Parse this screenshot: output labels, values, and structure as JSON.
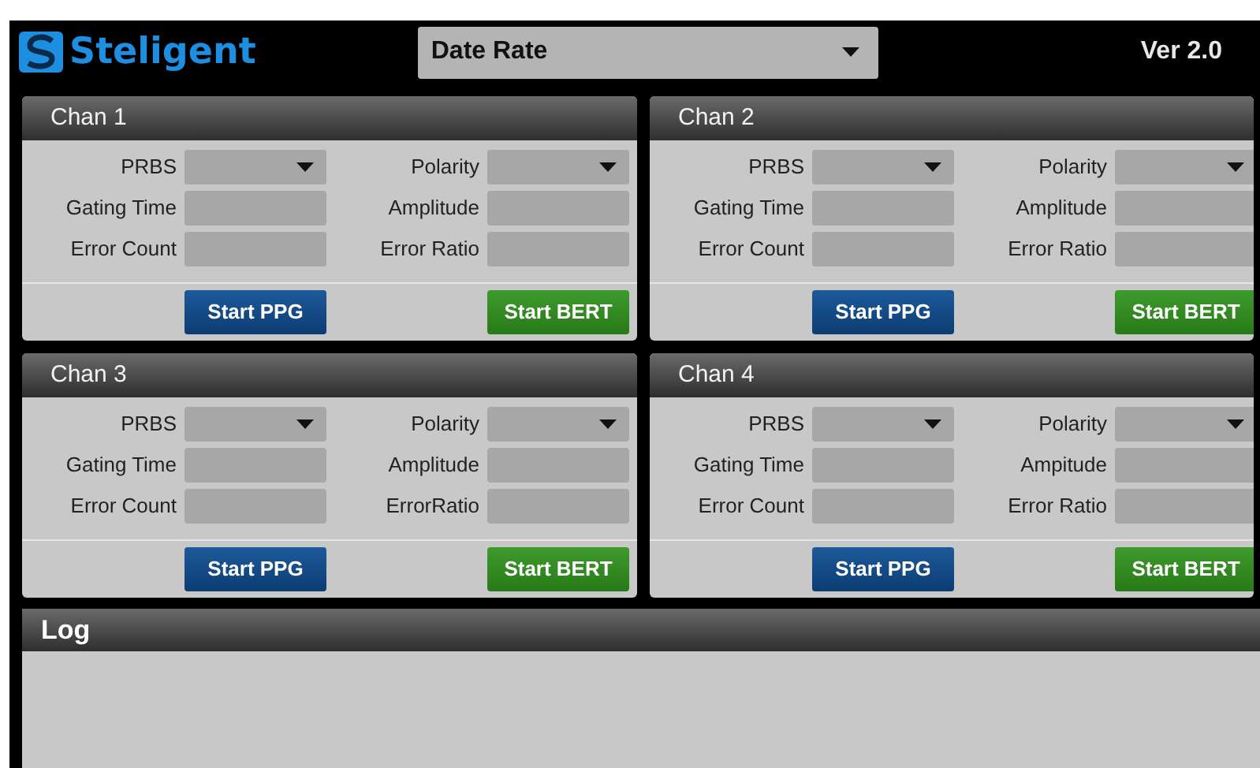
{
  "header": {
    "brand": "Steligent",
    "data_rate": {
      "value": "Date Rate"
    },
    "version": "Ver 2.0"
  },
  "channels": [
    {
      "title": "Chan 1",
      "fields": [
        {
          "label": "PRBS",
          "kind": "dropdown"
        },
        {
          "label": "Polarity",
          "kind": "dropdown"
        },
        {
          "label": "Gating Time",
          "kind": "text"
        },
        {
          "label": "Amplitude",
          "kind": "text"
        },
        {
          "label": "Error Count",
          "kind": "text"
        },
        {
          "label": "Error Ratio",
          "kind": "text"
        }
      ],
      "buttons": [
        {
          "label": "Start PPG",
          "kind": "ppg"
        },
        {
          "label": "Start BERT",
          "kind": "bert"
        }
      ]
    },
    {
      "title": "Chan 2",
      "fields": [
        {
          "label": "PRBS",
          "kind": "dropdown"
        },
        {
          "label": "Polarity",
          "kind": "dropdown"
        },
        {
          "label": "Gating Time",
          "kind": "text"
        },
        {
          "label": "Amplitude",
          "kind": "text"
        },
        {
          "label": "Error Count",
          "kind": "text"
        },
        {
          "label": "Error Ratio",
          "kind": "text"
        }
      ],
      "buttons": [
        {
          "label": "Start PPG",
          "kind": "ppg"
        },
        {
          "label": "Start BERT",
          "kind": "bert"
        }
      ]
    },
    {
      "title": "Chan 3",
      "fields": [
        {
          "label": "PRBS",
          "kind": "dropdown"
        },
        {
          "label": "Polarity",
          "kind": "dropdown"
        },
        {
          "label": "Gating Time",
          "kind": "text"
        },
        {
          "label": "Amplitude",
          "kind": "text"
        },
        {
          "label": "Error Count",
          "kind": "text"
        },
        {
          "label": "ErrorRatio",
          "kind": "text"
        }
      ],
      "buttons": [
        {
          "label": "Start PPG",
          "kind": "ppg"
        },
        {
          "label": "Start BERT",
          "kind": "bert"
        }
      ]
    },
    {
      "title": "Chan 4",
      "fields": [
        {
          "label": "PRBS",
          "kind": "dropdown"
        },
        {
          "label": "Polarity",
          "kind": "dropdown"
        },
        {
          "label": "Gating Time",
          "kind": "text"
        },
        {
          "label": "Ampitude",
          "kind": "text"
        },
        {
          "label": "Error Count",
          "kind": "text"
        },
        {
          "label": "Error Ratio",
          "kind": "text"
        }
      ],
      "buttons": [
        {
          "label": "Start PPG",
          "kind": "ppg"
        },
        {
          "label": "Start BERT",
          "kind": "bert"
        }
      ]
    }
  ],
  "log": {
    "title": "Log"
  }
}
